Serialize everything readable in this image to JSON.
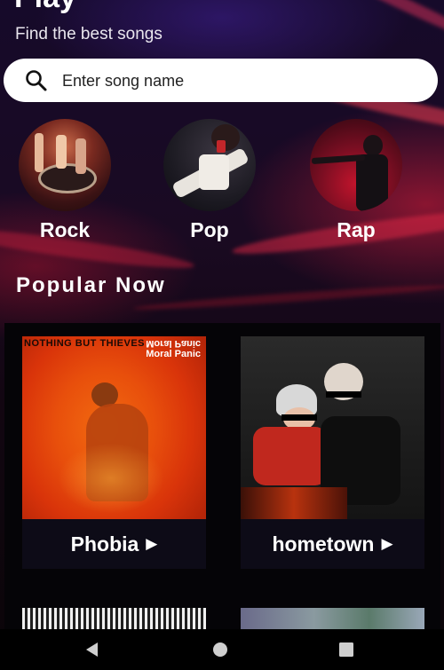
{
  "header": {
    "title_peek": "Play",
    "subtitle": "Find the best songs"
  },
  "search": {
    "placeholder": "Enter song name",
    "icon": "search-icon"
  },
  "genres": [
    {
      "label": "Rock"
    },
    {
      "label": "Pop"
    },
    {
      "label": "Rap"
    }
  ],
  "popular": {
    "title": "Popular Now",
    "cards": [
      {
        "name": "Phobia",
        "art_text_top": "NOTHING BUT THIEVES",
        "art_text_right_1": "Moral Panic",
        "art_text_right_2": "Moral Panic",
        "play_icon": "play-icon"
      },
      {
        "name": "hometown",
        "play_icon": "play-icon"
      }
    ]
  },
  "navbar": {
    "back": "back-icon",
    "home": "home-icon",
    "recents": "recents-icon"
  }
}
